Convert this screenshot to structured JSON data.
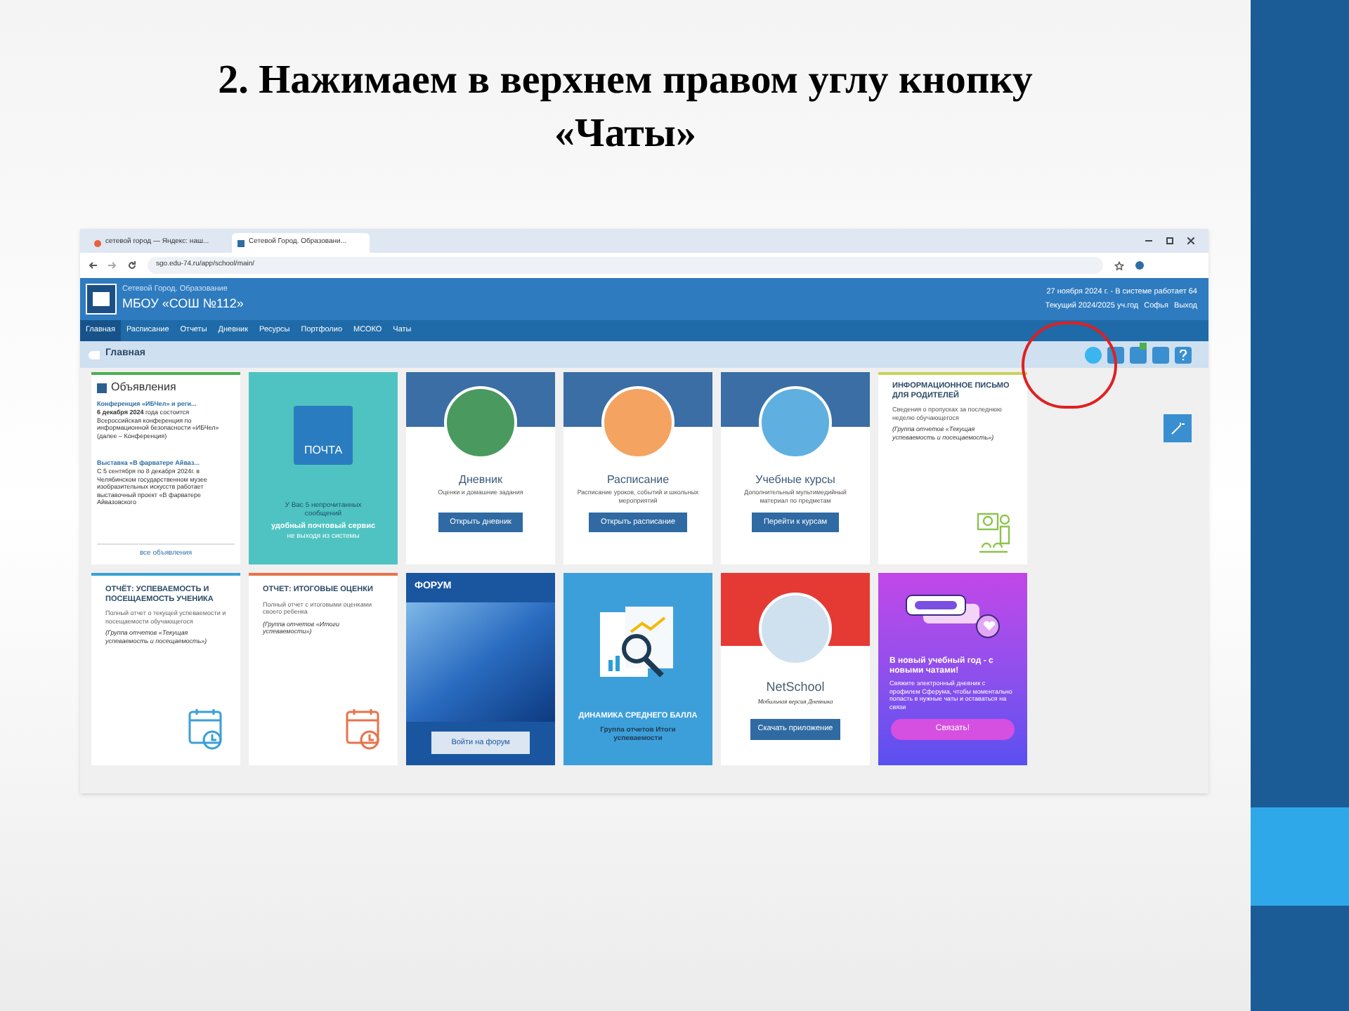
{
  "slide_title": [
    "2. Нажимаем в верхнем правом углу кнопку",
    "«Чаты»"
  ],
  "browser": {
    "tabs": [
      {
        "label": "сетевой город — Яндекс: наш...",
        "selected": false
      },
      {
        "label": "Сетевой Город. Образовани...",
        "selected": true
      }
    ],
    "url": "sgo.edu-74.ru/app/school/main/"
  },
  "header": {
    "system": "Сетевой Город. Образование",
    "school": "МБОУ «СОШ №112»",
    "date_line": "27 ноября 2024 г. - В системе работает 64",
    "year": "Текущий 2024/2025 уч.год",
    "user": "Софья",
    "logout": "Выход"
  },
  "nav": [
    {
      "label": "Главная",
      "selected": true
    },
    {
      "label": "Расписание",
      "selected": false
    },
    {
      "label": "Отчеты",
      "selected": false
    },
    {
      "label": "Дневник",
      "selected": false
    },
    {
      "label": "Ресурсы",
      "selected": false
    },
    {
      "label": "Портфолио",
      "selected": false
    },
    {
      "label": "МСОКО",
      "selected": false
    },
    {
      "label": "Чаты",
      "selected": false
    }
  ],
  "breadcrumb": "Главная",
  "cards": [
    {
      "kind": "announcements",
      "title": "Объявления",
      "items": [
        {
          "title": "Конференция «ИБЧел» и реги...",
          "text": "**6 декабря 2024** года состоится Всероссийская конференция по информационной безопасности «ИБЧел» (далее – Конференция)"
        },
        {
          "title": "Выставка «В фарватере Айваз...",
          "text": "С 5 сентября по 8 декабря 2024г. в Челябинском государственном музее изобразительных искусств работает выставочный проект «В фарватере Айвазовского"
        }
      ],
      "link": "все объявления"
    },
    {
      "kind": "mail",
      "label": "ПОЧТА",
      "unread": "У Вас 5 непрочитанных сообщений",
      "slogan": "удобный почтовый сервис",
      "note": "не выходя из системы"
    },
    {
      "kind": "feature",
      "title": "Дневник",
      "text": "Оценки и домашние задания",
      "button": "Открыть дневник"
    },
    {
      "kind": "feature",
      "title": "Расписание",
      "text": "Расписание уроков, событий и школьных мероприятий",
      "button": "Открыть расписание"
    },
    {
      "kind": "feature",
      "title": "Учебные курсы",
      "text": "Дополнительный мультимедийный материал по предметам",
      "button": "Перейти к курсам"
    },
    {
      "kind": "info",
      "title": "ИНФОРМАЦИОННОЕ ПИСЬМО ДЛЯ РОДИТЕЛЕЙ",
      "text": "Сведения о пропусках за последнюю неделю обучающегося",
      "note": "(Группа отчетов «Текущая успеваемость и посещаемость»)"
    },
    {
      "kind": "report",
      "color": "#3aa0d8",
      "title": "ОТЧЁТ: УСПЕВАЕМОСТЬ И ПОСЕЩАЕМОСТЬ УЧЕНИКА",
      "text": "Полный отчет о текущей успеваемости и посещаемости обучающегося",
      "note": "(Группа отчетов «Текущая успеваемость и посещаемость»)"
    },
    {
      "kind": "report",
      "color": "#e8734a",
      "title": "ОТЧЕТ: ИТОГОВЫЕ ОЦЕНКИ",
      "text": "Полный отчет с итоговыми оценками своего ребенка",
      "note": "(Группа отчетов «Итоги успеваемости»)"
    },
    {
      "kind": "forum",
      "title": "ФОРУМ",
      "button": "Войти на форум"
    },
    {
      "kind": "dynamics",
      "title": "ДИНАМИКА СРЕДНЕГО БАЛЛА",
      "text": "Группа отчетов Итоги успеваемости"
    },
    {
      "kind": "app",
      "title": "NetSchool",
      "text": "Мобильная версия Дневника",
      "button": "Скачать приложение"
    },
    {
      "kind": "promo",
      "title": "В новый учебный год - с новыми чатами!",
      "text": "Свяжите электронный дневник с профилем Сферума, чтобы моментально попасть в нужные чаты и оставаться на связи",
      "button": "Связать!"
    }
  ]
}
